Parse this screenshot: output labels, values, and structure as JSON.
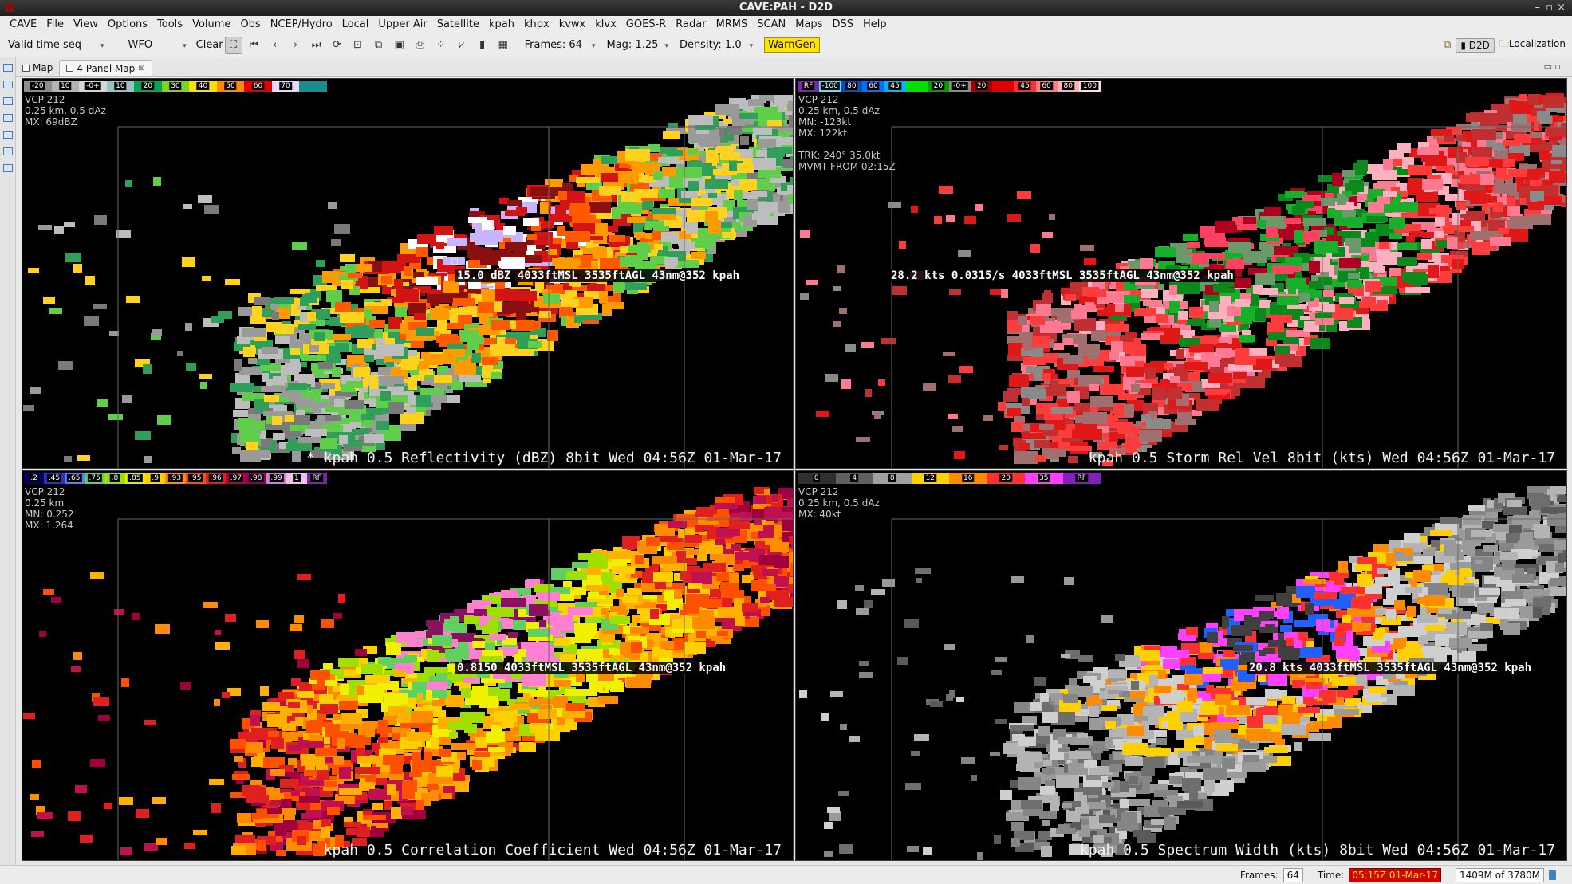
{
  "window": {
    "title": "CAVE:PAH - D2D"
  },
  "menu": [
    "CAVE",
    "File",
    "View",
    "Options",
    "Tools",
    "Volume",
    "Obs",
    "NCEP/Hydro",
    "Local",
    "Upper Air",
    "Satellite",
    "kpah",
    "khpx",
    "kvwx",
    "klvx",
    "GOES-R",
    "Radar",
    "MRMS",
    "SCAN",
    "Maps",
    "DSS",
    "Help"
  ],
  "toolbar": {
    "time_mode": "Valid time seq",
    "scale": "WFO",
    "clear_label": "Clear",
    "frames": "Frames: 64",
    "mag": "Mag: 1.25",
    "density": "Density: 1.0",
    "warngen": "WarnGen",
    "perspective": "D2D",
    "localization": "Localization"
  },
  "tabs": [
    {
      "label": "Map",
      "selected": false
    },
    {
      "label": "4 Panel Map",
      "selected": true
    }
  ],
  "panels": [
    {
      "id": "reflectivity",
      "info": [
        "VCP 212",
        "0.25 km, 0.5 dAz",
        "MX: 69dBZ"
      ],
      "sample": "15.0 dBZ 4033ftMSL 3535ftAGL 43nm@352 kpah",
      "legend": "* kpah 0.5  Reflectivity (dBZ) 8bit  Wed 04:56Z 01-Mar-17",
      "colorbar": [
        {
          "label": "-20",
          "color": "#8c8c8c"
        },
        {
          "label": "10",
          "color": "#b4b4b4"
        },
        {
          "label": "-0+",
          "color": "#d6d6d6"
        },
        {
          "label": "10",
          "color": "#9bc2c2"
        },
        {
          "label": "20",
          "color": "#00a65a"
        },
        {
          "label": "30",
          "color": "#86d11e"
        },
        {
          "label": "40",
          "color": "#ffe000"
        },
        {
          "label": "50",
          "color": "#ff8a00"
        },
        {
          "label": "60",
          "color": "#e00000"
        },
        {
          "label": "70",
          "color": "#e8d8ff"
        },
        {
          "label": "",
          "color": "#1a8e8e"
        }
      ]
    },
    {
      "id": "storm-rel-vel",
      "info": [
        "VCP 212",
        "0.25 km, 0.5 dAz",
        "MN: -123kt",
        "MX: 122kt",
        "",
        "TRK: 240° 35.0kt",
        "MVMT FROM 02:15Z"
      ],
      "sample": "28.2 kts 0.0315/s 4033ftMSL 3535ftAGL 43nm@352 kpah",
      "legend": "kpah 0.5  Storm Rel Vel 8bit (kts)  Wed 04:56Z 01-Mar-17",
      "colorbar": [
        {
          "label": "RF",
          "color": "#7a2aa0"
        },
        {
          "label": "-100",
          "color": "#3cf0ff"
        },
        {
          "label": "80",
          "color": "#0050c0"
        },
        {
          "label": "60",
          "color": "#0070ff"
        },
        {
          "label": "45",
          "color": "#00b4ff"
        },
        {
          "label": "",
          "color": "#00e000"
        },
        {
          "label": "20",
          "color": "#00a000"
        },
        {
          "label": "-0+",
          "color": "#8c8c8c"
        },
        {
          "label": "20",
          "color": "#a00000"
        },
        {
          "label": "",
          "color": "#e00000"
        },
        {
          "label": "45",
          "color": "#ff3030"
        },
        {
          "label": "60",
          "color": "#ff8080"
        },
        {
          "label": "80",
          "color": "#ffb0b0"
        },
        {
          "label": "100",
          "color": "#ffe0e0"
        }
      ]
    },
    {
      "id": "correlation-coefficient",
      "info": [
        "VCP 212",
        "0.25 km",
        "MN: 0.252",
        "MX: 1.264"
      ],
      "sample": "0.8150  4033ftMSL 3535ftAGL 43nm@352 kpah",
      "legend": "kpah 0.5  Correlation Coefficient  Wed 04:56Z 01-Mar-17",
      "colorbar": [
        {
          "label": ".2",
          "color": "#000060"
        },
        {
          "label": ".45",
          "color": "#3030c0"
        },
        {
          "label": ".65",
          "color": "#5080ff"
        },
        {
          "label": ".75",
          "color": "#60d060"
        },
        {
          "label": ".8",
          "color": "#a0e000"
        },
        {
          "label": ".85",
          "color": "#e0f000"
        },
        {
          "label": ".9",
          "color": "#ffd000"
        },
        {
          "label": ".93",
          "color": "#ff8c00"
        },
        {
          "label": ".95",
          "color": "#ff5000"
        },
        {
          "label": ".96",
          "color": "#e02020"
        },
        {
          "label": ".97",
          "color": "#b00040"
        },
        {
          "label": ".98",
          "color": "#900060"
        },
        {
          "label": ".99",
          "color": "#d080d0"
        },
        {
          "label": "1",
          "color": "#f0c0f0"
        },
        {
          "label": "RF",
          "color": "#7a2aa0"
        }
      ]
    },
    {
      "id": "spectrum-width",
      "info": [
        "VCP 212",
        "0.25 km, 0.5 dAz",
        "MX: 40kt"
      ],
      "sample": "20.8 kts 4033ftMSL 3535ftAGL 43nm@352 kpah",
      "legend": "kpah 0.5  Spectrum Width (kts) 8bit  Wed 04:56Z 01-Mar-17",
      "colorbar": [
        {
          "label": "0",
          "color": "#303030"
        },
        {
          "label": "4",
          "color": "#606060"
        },
        {
          "label": "8",
          "color": "#a0a0a0"
        },
        {
          "label": "12",
          "color": "#ffd000"
        },
        {
          "label": "16",
          "color": "#ff8c00"
        },
        {
          "label": "20",
          "color": "#ff3030"
        },
        {
          "label": "35",
          "color": "#ff40ff"
        },
        {
          "label": "RF",
          "color": "#8020c0"
        }
      ]
    }
  ],
  "status": {
    "frames_label": "Frames:",
    "frames_value": "64",
    "time_label": "Time:",
    "time_value": "05:15Z 01-Mar-17",
    "memory": "1409M of 3780M"
  },
  "icons": [
    "app-icon",
    "first-frame-icon",
    "step-back-icon",
    "step-forward-icon",
    "last-frame-icon",
    "loop-icon",
    "trash-icon"
  ]
}
